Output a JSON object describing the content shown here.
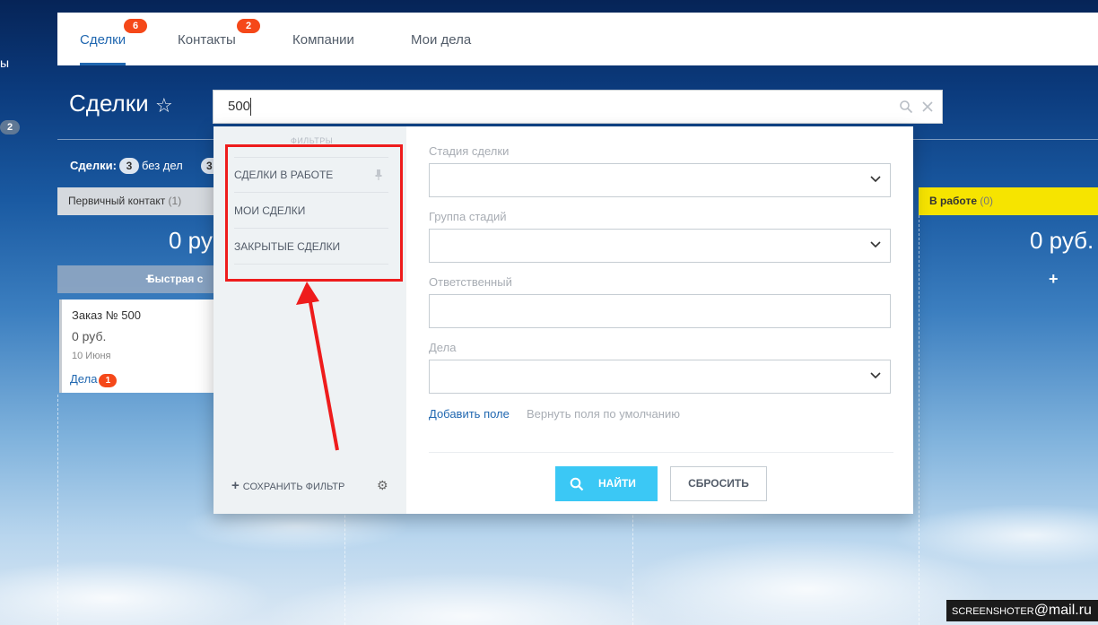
{
  "left_fragment": "ы",
  "left_badge": "2",
  "tabs": [
    {
      "label": "Сделки",
      "badge": "6"
    },
    {
      "label": "Контакты",
      "badge": "2"
    },
    {
      "label": "Компании"
    },
    {
      "label": "Мои дела"
    }
  ],
  "page": {
    "title": "Сделки",
    "star": "☆"
  },
  "counters": {
    "label": "Сделки:",
    "count": "3",
    "suffix": "без дел",
    "count2": "3"
  },
  "columns": [
    {
      "title": "Первичный контакт",
      "count": "(1)",
      "sum": "0 ру",
      "color": "#d5d9de"
    },
    {
      "title": "В работе",
      "count": "(0)",
      "sum": "0 руб.",
      "color": "#f6e400"
    }
  ],
  "quick_add": "Быстрая с",
  "card": {
    "title": "Заказ № 500",
    "sum": "0 руб.",
    "date": "10 Июня",
    "activities": "Дела",
    "activities_count": "1"
  },
  "search": {
    "value": "500"
  },
  "filter": {
    "presets_header": "ФИЛЬТРЫ",
    "presets": [
      "СДЕЛКИ В РАБОТЕ",
      "МОИ СДЕЛКИ",
      "ЗАКРЫТЫЕ СДЕЛКИ"
    ],
    "save_filter": "СОХРАНИТЬ ФИЛЬТР",
    "fields": [
      {
        "label": "Стадия сделки",
        "type": "select"
      },
      {
        "label": "Группа стадий",
        "type": "select"
      },
      {
        "label": "Ответственный",
        "type": "input"
      },
      {
        "label": "Дела",
        "type": "select"
      }
    ],
    "add_field": "Добавить поле",
    "reset_fields": "Вернуть поля по умолчанию",
    "find": "НАЙТИ",
    "reset": "СБРОСИТЬ"
  },
  "watermark": {
    "left": "SCREENSHOTER",
    "right": "@mail.ru"
  },
  "colors": {
    "accent": "#2067b0",
    "badge": "#f54819",
    "find_button": "#3bc8f5",
    "annotation": "#ee1c1c"
  }
}
